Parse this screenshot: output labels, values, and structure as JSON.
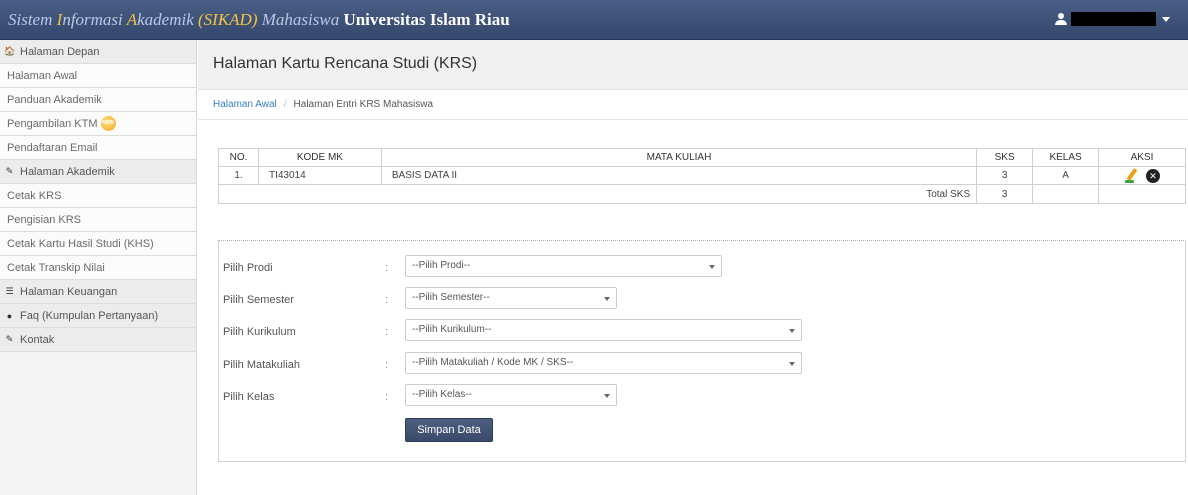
{
  "brand": {
    "part1": "Sistem ",
    "cap1": "I",
    "part2": "nformasi ",
    "cap2": "A",
    "part3": "kademik ",
    "highlight": "(SIKAD)",
    "part4": " Mahasiswa ",
    "bold": "Universitas Islam Riau"
  },
  "sidebar": {
    "items": [
      {
        "label": "Halaman Depan",
        "type": "header",
        "icon": "home-icon",
        "glyph": "🏠"
      },
      {
        "label": "Halaman Awal",
        "type": "sub"
      },
      {
        "label": "Panduan Akademik",
        "type": "sub"
      },
      {
        "label": "Pengambilan KTM",
        "type": "sub",
        "badge": "NEW"
      },
      {
        "label": "Pendaftaran Email",
        "type": "sub"
      },
      {
        "label": "Halaman Akademik",
        "type": "header",
        "icon": "book-icon",
        "glyph": "✎"
      },
      {
        "label": "Cetak KRS",
        "type": "sub"
      },
      {
        "label": "Pengisian KRS",
        "type": "sub"
      },
      {
        "label": "Cetak Kartu Hasil Studi (KHS)",
        "type": "sub"
      },
      {
        "label": "Cetak Transkip Nilai",
        "type": "sub"
      },
      {
        "label": "Halaman Keuangan",
        "type": "header",
        "icon": "list-icon",
        "glyph": "☰"
      },
      {
        "label": "Faq (Kumpulan Pertanyaan)",
        "type": "header",
        "icon": "comment-icon",
        "glyph": "●"
      },
      {
        "label": "Kontak",
        "type": "header",
        "icon": "book-icon",
        "glyph": "✎"
      }
    ]
  },
  "page": {
    "title": "Halaman Kartu Rencana Studi (KRS)",
    "breadcrumb_home": "Halaman Awal",
    "breadcrumb_sep": "/",
    "breadcrumb_current": "Halaman Entri KRS Mahasiswa"
  },
  "table": {
    "headers": [
      "NO.",
      "KODE MK",
      "MATA KULIAH",
      "SKS",
      "KELAS",
      "AKSI"
    ],
    "rows": [
      {
        "no": "1.",
        "kode": "TI43014",
        "matkul": "BASIS DATA II",
        "sks": "3",
        "kelas": "A"
      }
    ],
    "total_label": "Total SKS",
    "total_value": "3"
  },
  "form": {
    "prodi_label": "Pilih Prodi",
    "prodi_value": "--Pilih Prodi--",
    "semester_label": "Pilih Semester",
    "semester_value": "--Pilih Semester--",
    "kurikulum_label": "Pilih Kurikulum",
    "kurikulum_value": "--Pilih Kurikulum--",
    "matakuliah_label": "Pilih Matakuliah",
    "matakuliah_value": "--Pilih Matakuliah / Kode MK / SKS--",
    "kelas_label": "Pilih Kelas",
    "kelas_value": "--Pilih Kelas--",
    "colon": ":",
    "save_label": "Simpan Data"
  },
  "colors": {
    "navbar": "#3d5078",
    "accent": "#f3c441",
    "link": "#3a7ec2",
    "button": "#4d5f82"
  }
}
